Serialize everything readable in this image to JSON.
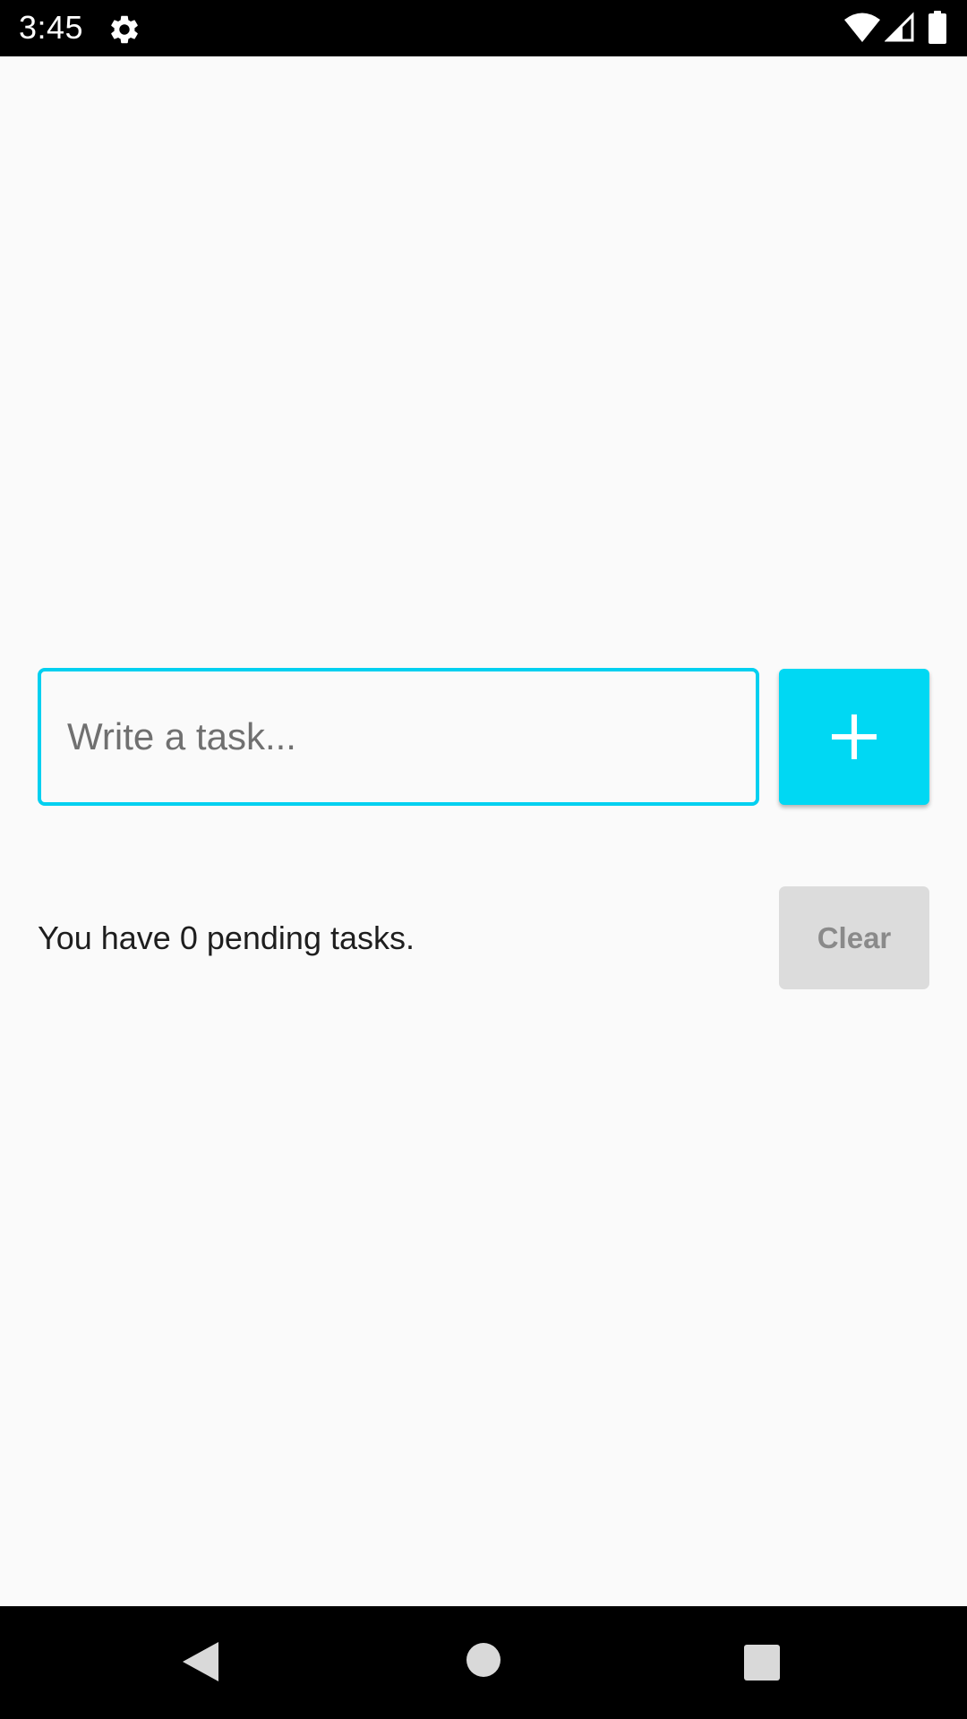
{
  "status_bar": {
    "time": "3:45",
    "icons": [
      "gear-icon",
      "wifi-icon",
      "signal-icon",
      "battery-icon"
    ]
  },
  "task_input": {
    "value": "",
    "placeholder": "Write a task..."
  },
  "add_button": {
    "icon": "plus-icon"
  },
  "pending": {
    "text": "You have 0 pending tasks."
  },
  "clear_button": {
    "label": "Clear",
    "enabled": false
  },
  "nav_bar": {
    "icons": [
      "back-icon",
      "home-icon",
      "recents-icon"
    ]
  },
  "colors": {
    "accent": "#00d8f3",
    "input_border": "#00d0f0",
    "background": "#fafafa",
    "system_bars": "#000000",
    "disabled_button": "#dcdcdc",
    "disabled_text": "#8a8a8a"
  }
}
